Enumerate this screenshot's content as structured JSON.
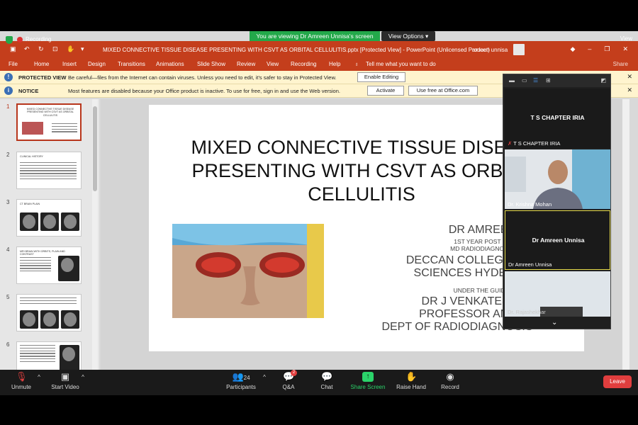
{
  "zoom": {
    "banner": "You are viewing Dr Amreen Unnisa's screen",
    "view_options": "View Options ▾",
    "recording": "Recording",
    "top_view": "View"
  },
  "ppt": {
    "window_title": "MIXED CONNECTIVE TISSUE DISEASE PRESENTING WITH CSVT AS ORBITAL CELLULITIS.pptx [Protected View] - PowerPoint (Unlicensed Product)",
    "user": "ameen unnisa",
    "tabs": [
      "File",
      "Home",
      "Insert",
      "Design",
      "Transitions",
      "Animations",
      "Slide Show",
      "Review",
      "View",
      "Recording",
      "Help"
    ],
    "tell_me": "Tell me what you want to do",
    "share": "Share"
  },
  "protected_bar": {
    "label": "PROTECTED VIEW",
    "message": "Be careful—files from the Internet can contain viruses. Unless you need to edit, it's safer to stay in Protected View.",
    "button": "Enable Editing"
  },
  "notice_bar": {
    "label": "NOTICE",
    "message": "Most features are disabled because your Office product is inactive. To use for free, sign in and use the Web version.",
    "activate": "Activate",
    "use_free": "Use free at Office.com"
  },
  "thumbnails": [
    {
      "num": "1",
      "title": "MIXED CONNECTIVE TISSUE DISEASE PRESENTING WITH CSVT AS ORBITAL CELLULITIS"
    },
    {
      "num": "2",
      "title": "CLINICAL HISTORY"
    },
    {
      "num": "3",
      "title": "CT BRAIN PLAIN"
    },
    {
      "num": "4",
      "title": "MRI BRAIN WITH ORBITS, PLAIN AND CONTRAST"
    },
    {
      "num": "5",
      "title": ""
    },
    {
      "num": "6",
      "title": ""
    }
  ],
  "slide": {
    "title_lines": [
      "MIXED CONNECTIVE TISSUE DISEAS",
      "PRESENTING WITH CSVT AS ORBITA",
      "CELLULITIS"
    ],
    "author": "DR AMREEN UNN",
    "year": "1ST YEAR POST GRADUAT",
    "degree": "MD RADIODIAGNOSIS",
    "college1": "DECCAN COLLEGE OF",
    "college2": "SCIENCES HYDERA",
    "guidance": "UNDER THE GUIDANCE OF",
    "guide": "DR J VENKATESHWA",
    "guide_role": "PROFESSOR AND",
    "dept": "DEPT OF RADIODIAGNOSIS"
  },
  "video_panel": {
    "tile1_center": "T S CHAPTER IRIA",
    "tile1_name": "T S CHAPTER IRIA",
    "tile2_name": "Dr. Krishna Mohan",
    "tile3_center": "Dr Amreen Unnisa",
    "tile3_name": "Dr Amreen Unnisa",
    "tile4_name": "Dr. Rajashekhar"
  },
  "toolbar": {
    "unmute": "Unmute",
    "start_video": "Start Video",
    "participants": "Participants",
    "participants_count": "24",
    "qa": "Q&A",
    "qa_badge": "2",
    "chat": "Chat",
    "share_screen": "Share Screen",
    "raise_hand": "Raise Hand",
    "record": "Record",
    "leave": "Leave"
  },
  "colors": {
    "ppt_red": "#c43e1c",
    "zoom_green": "#23a84a",
    "leave_red": "#e03e3e"
  }
}
